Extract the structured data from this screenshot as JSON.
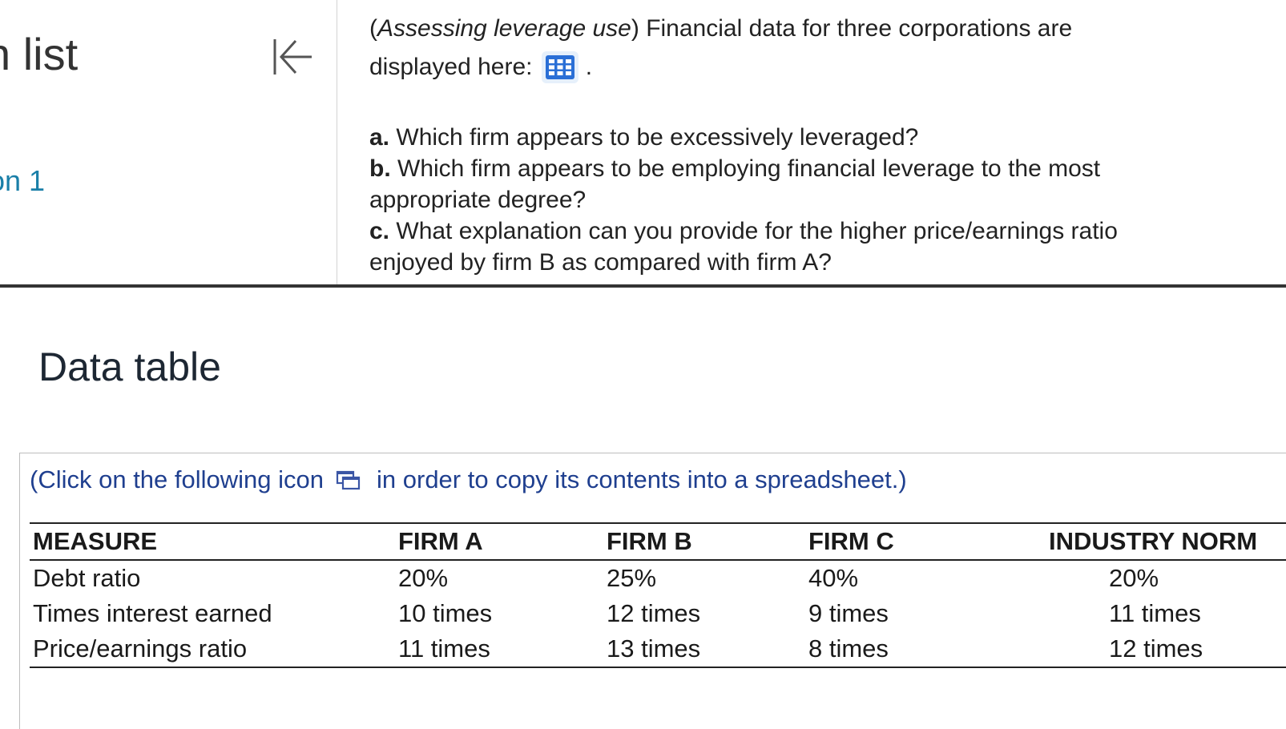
{
  "left_panel": {
    "title_fragment": "n list",
    "link_fragment": "on 1"
  },
  "question": {
    "lead_italic": "Assessing leverage use",
    "intro_text": "Financial data for three corporations are",
    "intro_line2": "displayed here:",
    "parts": [
      {
        "letter": "a.",
        "text": "Which firm appears to be excessively leveraged?"
      },
      {
        "letter": "b.",
        "text": "Which firm appears to be employing financial leverage to the most"
      },
      {
        "letter": "",
        "text": "appropriate degree?"
      },
      {
        "letter": "c.",
        "text": "What explanation can you provide for the higher price/earnings ratio"
      },
      {
        "letter": "",
        "text": "enjoyed by firm B as compared with firm A?"
      }
    ]
  },
  "data_table": {
    "title": "Data table",
    "copy_hint_before": "(Click on the following icon",
    "copy_hint_after": "in order to copy its contents into a spreadsheet.)",
    "headers": [
      "MEASURE",
      "FIRM A",
      "FIRM B",
      "FIRM C",
      "INDUSTRY NORM"
    ],
    "rows": [
      [
        "Debt ratio",
        "20%",
        "25%",
        "40%",
        "20%"
      ],
      [
        "Times interest earned",
        "10 times",
        "12 times",
        "9 times",
        "11 times"
      ],
      [
        "Price/earnings ratio",
        "11 times",
        "13 times",
        "8 times",
        "12 times"
      ]
    ]
  },
  "colors": {
    "link": "#1a7fa8",
    "hint_text": "#1f3f8f",
    "grid_icon": "#2a6fd6"
  },
  "icons": {
    "collapse": "collapse-left-icon",
    "data_grid": "table-grid-icon",
    "copy": "copy-spreadsheet-icon"
  }
}
